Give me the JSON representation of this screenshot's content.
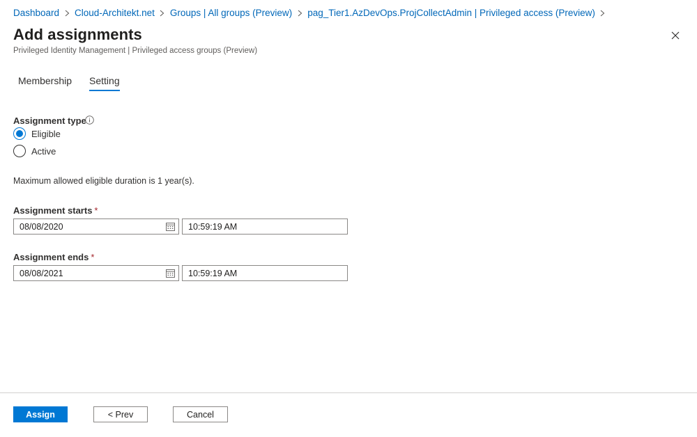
{
  "breadcrumb": [
    {
      "label": "Dashboard"
    },
    {
      "label": "Cloud-Architekt.net"
    },
    {
      "label": "Groups | All groups (Preview)"
    },
    {
      "label": "pag_Tier1.AzDevOps.ProjCollectAdmin | Privileged access (Preview)"
    }
  ],
  "page": {
    "title": "Add assignments",
    "subtitle": "Privileged Identity Management | Privileged access groups (Preview)"
  },
  "tabs": [
    {
      "label": "Membership",
      "active": false
    },
    {
      "label": "Setting",
      "active": true
    }
  ],
  "assignment_type": {
    "label": "Assignment type",
    "info_icon": "info-icon",
    "options": [
      {
        "label": "Eligible",
        "checked": true
      },
      {
        "label": "Active",
        "checked": false
      }
    ]
  },
  "duration_info": "Maximum allowed eligible duration is 1 year(s).",
  "assignment_starts": {
    "label": "Assignment starts",
    "required_mark": "*",
    "date": "08/08/2020",
    "time": "10:59:19 AM"
  },
  "assignment_ends": {
    "label": "Assignment ends",
    "required_mark": "*",
    "date": "08/08/2021",
    "time": "10:59:19 AM"
  },
  "footer": {
    "assign_label": "Assign",
    "prev_label": "< Prev",
    "cancel_label": "Cancel"
  },
  "colors": {
    "accent": "#0078d4",
    "link": "#0067b8",
    "required": "#a4262c"
  }
}
